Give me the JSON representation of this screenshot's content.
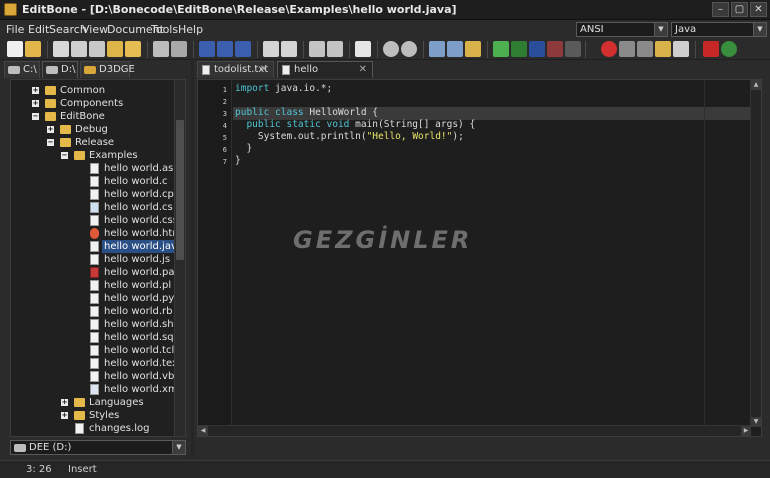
{
  "window": {
    "title": "EditBone - [D:\\Bonecode\\EditBone\\Release\\Examples\\hello world.java]",
    "controls": [
      "–",
      "▢",
      "✕"
    ]
  },
  "menu": [
    "File",
    "Edit",
    "Search",
    "View",
    "Document",
    "Tools",
    "Help"
  ],
  "encoding_select": {
    "value": "ANSI"
  },
  "highlighter_select": {
    "value": "Java"
  },
  "left_tabs": [
    {
      "label": "C:\\"
    },
    {
      "label": "D:\\"
    },
    {
      "label": "D3DGE"
    }
  ],
  "tree": {
    "items": [
      {
        "label": "Common",
        "type": "folder",
        "expander": "+"
      },
      {
        "label": "Components",
        "type": "folder",
        "expander": "+"
      },
      {
        "label": "EditBone",
        "type": "folder",
        "expander": "−"
      },
      {
        "label": "Debug",
        "type": "folder",
        "expander": "+"
      },
      {
        "label": "Release",
        "type": "folder",
        "expander": "−"
      },
      {
        "label": "Examples",
        "type": "folder",
        "expander": "−"
      },
      {
        "label": "hello world.asm",
        "type": "file"
      },
      {
        "label": "hello world.c",
        "type": "file"
      },
      {
        "label": "hello world.cpp",
        "type": "file"
      },
      {
        "label": "hello world.cs",
        "type": "file"
      },
      {
        "label": "hello world.css",
        "type": "file"
      },
      {
        "label": "hello world.html",
        "type": "file"
      },
      {
        "label": "hello world.java",
        "type": "file",
        "selected": true
      },
      {
        "label": "hello world.js",
        "type": "file"
      },
      {
        "label": "hello world.pas",
        "type": "file"
      },
      {
        "label": "hello world.pl",
        "type": "file"
      },
      {
        "label": "hello world.py",
        "type": "file"
      },
      {
        "label": "hello world.rb",
        "type": "file"
      },
      {
        "label": "hello world.sh",
        "type": "file"
      },
      {
        "label": "hello world.sql",
        "type": "file"
      },
      {
        "label": "hello world.tcl",
        "type": "file"
      },
      {
        "label": "hello world.tex",
        "type": "file"
      },
      {
        "label": "hello world.vb",
        "type": "file"
      },
      {
        "label": "hello world.xml",
        "type": "file"
      },
      {
        "label": "Languages",
        "type": "folder",
        "expander": "+"
      },
      {
        "label": "Styles",
        "type": "folder",
        "expander": "+"
      },
      {
        "label": "changes.log",
        "type": "file"
      }
    ]
  },
  "drive_select": {
    "value": "DEE (D:)"
  },
  "editor_tabs": [
    {
      "label": "todolist.txt",
      "close": "✕"
    },
    {
      "label": "hello world.java",
      "close": "✕"
    }
  ],
  "editor": {
    "line_numbers": [
      "1",
      "2",
      "3",
      "4",
      "5",
      "6",
      "7"
    ],
    "lines": [
      [
        {
          "t": "import",
          "c": "kw"
        },
        {
          "t": " java.io.*;",
          "c": ""
        }
      ],
      [],
      [
        {
          "t": "public class",
          "c": "kw"
        },
        {
          "t": " HelloWorld {",
          "c": ""
        }
      ],
      [
        {
          "t": "  public static void",
          "c": "kw"
        },
        {
          "t": " main(String[] args) {",
          "c": ""
        }
      ],
      [
        {
          "t": "    System.out.println(",
          "c": ""
        },
        {
          "t": "\"Hello, World!\"",
          "c": "str"
        },
        {
          "t": ");",
          "c": ""
        }
      ],
      [
        {
          "t": "  }",
          "c": ""
        }
      ],
      [
        {
          "t": "}",
          "c": ""
        }
      ]
    ]
  },
  "watermark": {
    "text": "GEZGİNLER"
  },
  "status": {
    "position": "3: 26",
    "mode": "Insert"
  },
  "colors": {
    "keyword": "#4fc4d4",
    "string": "#e8e36a",
    "selection": "#2a4e86"
  }
}
